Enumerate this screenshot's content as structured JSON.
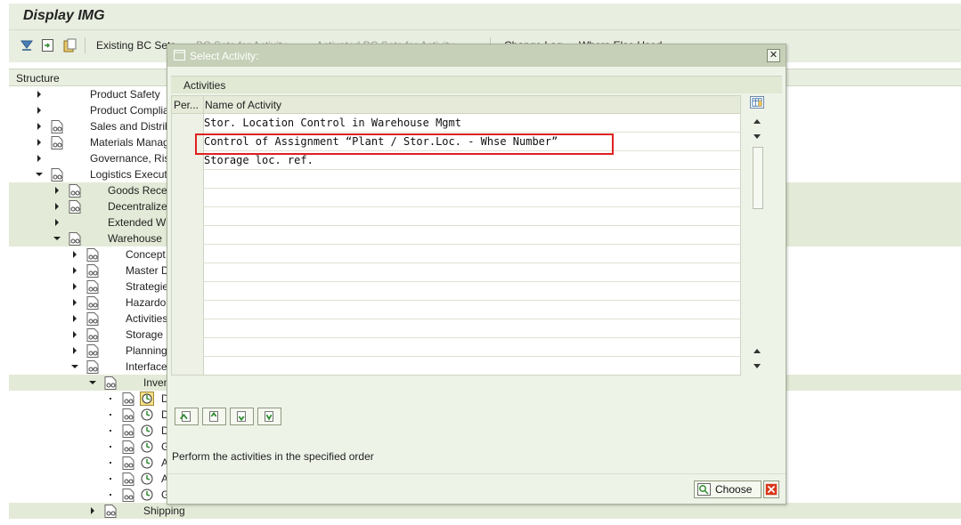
{
  "window": {
    "title": "Display IMG"
  },
  "toolbar": {
    "existing_bc_sets": "Existing BC Sets",
    "bc_sets_for_activity": "BC Sets for Activity",
    "activated_bc_sets": "Activated BC Sets for Activity",
    "change_log": "Change Log",
    "where_else_used": "Where Else Used"
  },
  "structure": {
    "header": "Structure",
    "rows": [
      {
        "label": "Product Safety"
      },
      {
        "label": "Product Compliance"
      },
      {
        "label": "Sales and Distribution"
      },
      {
        "label": "Materials Management"
      },
      {
        "label": "Governance, Risk"
      },
      {
        "label": "Logistics Execution"
      },
      {
        "label": "Goods Receipt"
      },
      {
        "label": "Decentralized"
      },
      {
        "label": "Extended W"
      },
      {
        "label": "Warehouse"
      },
      {
        "label": "Concept"
      },
      {
        "label": "Master D"
      },
      {
        "label": "Strategies"
      },
      {
        "label": "Hazardous"
      },
      {
        "label": "Activities"
      },
      {
        "label": "Storage"
      },
      {
        "label": "Planning"
      },
      {
        "label": "Interfaces"
      },
      {
        "label": "Inventory"
      },
      {
        "label": "D"
      },
      {
        "label": "D"
      },
      {
        "label": "D"
      },
      {
        "label": "G"
      },
      {
        "label": "A"
      },
      {
        "label": "A"
      },
      {
        "label": "G"
      },
      {
        "label": "Shipping"
      }
    ]
  },
  "dialog": {
    "title": "Select Activity:",
    "close_glyph": "✕",
    "section_label": "Activities",
    "columns": {
      "perform": "Per...",
      "name": "Name of Activity"
    },
    "activities": [
      "Stor. Location Control in Warehouse Mgmt",
      "Control of Assignment “Plant / Stor.Loc. - Whse Number”",
      "Storage loc. ref."
    ],
    "hint": "Perform the activities in the specified order",
    "choose_label": "Choose"
  },
  "colors": {
    "sap_green_bg": "#e8eee0",
    "dialog_title_bg": "#c6d0b8",
    "highlight_red": "#e02020"
  }
}
